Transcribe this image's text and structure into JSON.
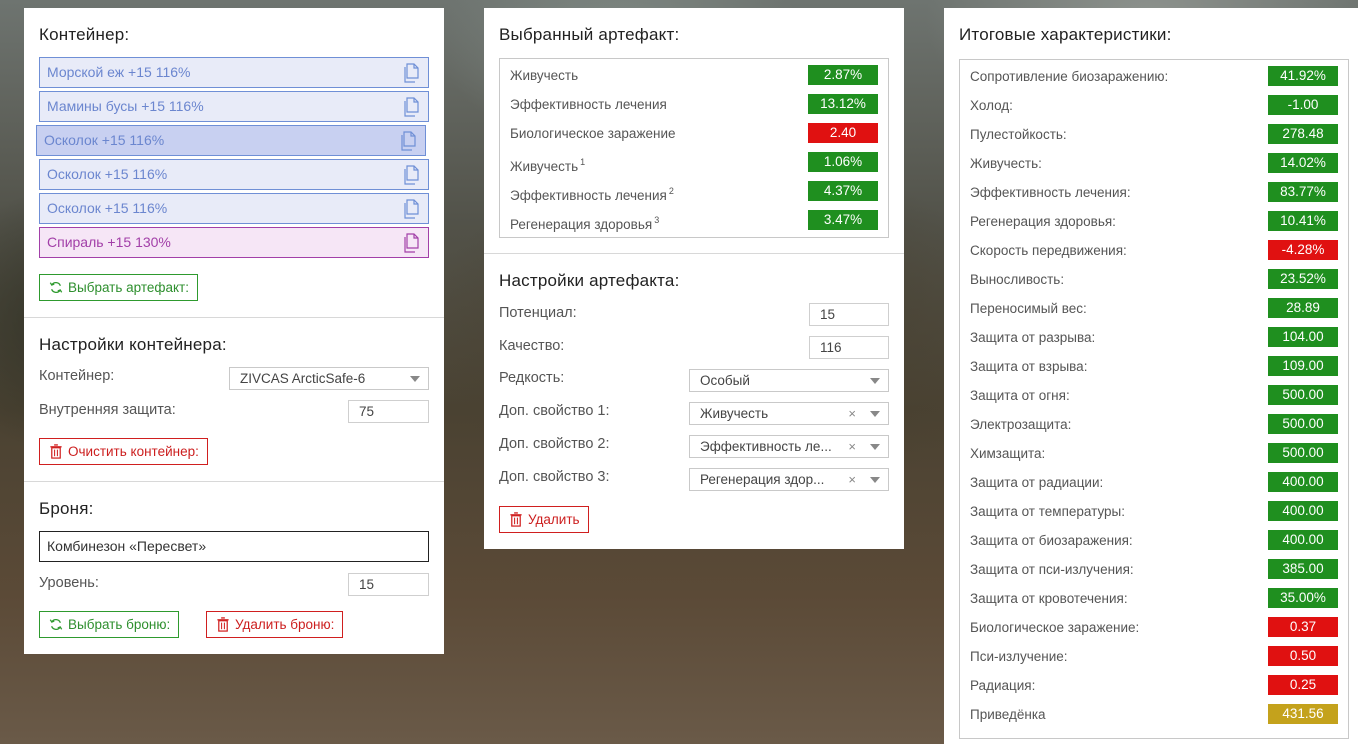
{
  "container_panel": {
    "title": "Контейнер:",
    "items": [
      {
        "label": "Морской еж +15 116%",
        "state": "normal"
      },
      {
        "label": "Мамины бусы +15 116%",
        "state": "normal"
      },
      {
        "label": "Осколок +15 116%",
        "state": "active"
      },
      {
        "label": "Осколок +15 116%",
        "state": "normal"
      },
      {
        "label": "Осколок +15 116%",
        "state": "normal"
      },
      {
        "label": "Спираль +15 130%",
        "state": "purple"
      }
    ],
    "select_artifact_label": "Выбрать артефакт:",
    "settings_title": "Настройки контейнера:",
    "container_label": "Контейнер:",
    "container_value": "ZIVCAS ArcticSafe-6",
    "inner_protection_label": "Внутренняя защита:",
    "inner_protection_value": "75",
    "clear_label": "Очистить контейнер:",
    "armor_title": "Броня:",
    "armor_value": "Комбинезон «Пересвет»",
    "level_label": "Уровень:",
    "level_value": "15",
    "select_armor_label": "Выбрать броню:",
    "delete_armor_label": "Удалить броню:"
  },
  "artifact_panel": {
    "title": "Выбранный артефакт:",
    "stats": [
      {
        "name": "Живучесть",
        "sup": "",
        "value": "2.87%",
        "color": "green"
      },
      {
        "name": "Эффективность лечения",
        "sup": "",
        "value": "13.12%",
        "color": "green"
      },
      {
        "name": "Биологическое заражение",
        "sup": "",
        "value": "2.40",
        "color": "red"
      },
      {
        "name": "Живучесть",
        "sup": "1",
        "value": "1.06%",
        "color": "green"
      },
      {
        "name": "Эффективность лечения",
        "sup": "2",
        "value": "4.37%",
        "color": "green"
      },
      {
        "name": "Регенерация здоровья",
        "sup": "3",
        "value": "3.47%",
        "color": "green"
      }
    ],
    "settings_title": "Настройки артефакта:",
    "potential_label": "Потенциал:",
    "potential_value": "15",
    "quality_label": "Качество:",
    "quality_value": "116",
    "rarity_label": "Редкость:",
    "rarity_value": "Особый",
    "prop1_label": "Доп. свойство 1:",
    "prop1_value": "Живучесть",
    "prop2_label": "Доп. свойство 2:",
    "prop2_value": "Эффективность ле...",
    "prop3_label": "Доп. свойство 3:",
    "prop3_value": "Регенерация здор...",
    "clear_symbol": "×",
    "delete_label": "Удалить"
  },
  "totals_panel": {
    "title": "Итоговые характеристики:",
    "stats": [
      {
        "name": "Сопротивление биозаражению:",
        "value": "41.92%",
        "color": "green"
      },
      {
        "name": "Холод:",
        "value": "-1.00",
        "color": "green"
      },
      {
        "name": "Пулестойкость:",
        "value": "278.48",
        "color": "green"
      },
      {
        "name": "Живучесть:",
        "value": "14.02%",
        "color": "green"
      },
      {
        "name": "Эффективность лечения:",
        "value": "83.77%",
        "color": "green"
      },
      {
        "name": "Регенерация здоровья:",
        "value": "10.41%",
        "color": "green"
      },
      {
        "name": "Скорость передвижения:",
        "value": "-4.28%",
        "color": "red"
      },
      {
        "name": "Выносливость:",
        "value": "23.52%",
        "color": "green"
      },
      {
        "name": "Переносимый вес:",
        "value": "28.89",
        "color": "green"
      },
      {
        "name": "Защита от разрыва:",
        "value": "104.00",
        "color": "green"
      },
      {
        "name": "Защита от взрыва:",
        "value": "109.00",
        "color": "green"
      },
      {
        "name": "Защита от огня:",
        "value": "500.00",
        "color": "green"
      },
      {
        "name": "Электрозащита:",
        "value": "500.00",
        "color": "green"
      },
      {
        "name": "Химзащита:",
        "value": "500.00",
        "color": "green"
      },
      {
        "name": "Защита от радиации:",
        "value": "400.00",
        "color": "green"
      },
      {
        "name": "Защита от температуры:",
        "value": "400.00",
        "color": "green"
      },
      {
        "name": "Защита от биозаражения:",
        "value": "400.00",
        "color": "green"
      },
      {
        "name": "Защита от пси-излучения:",
        "value": "385.00",
        "color": "green"
      },
      {
        "name": "Защита от кровотечения:",
        "value": "35.00%",
        "color": "green"
      },
      {
        "name": "Биологическое заражение:",
        "value": "0.37",
        "color": "red"
      },
      {
        "name": "Пси-излучение:",
        "value": "0.50",
        "color": "red"
      },
      {
        "name": "Радиация:",
        "value": "0.25",
        "color": "red"
      },
      {
        "name": "Приведёнка",
        "value": "431.56",
        "color": "yellow"
      }
    ]
  },
  "colors": {
    "green": "#1f8f1f",
    "red": "#e01111",
    "yellow": "#c4a21c",
    "container_blue": "#6f8fd6",
    "container_purple": "#a23fa8"
  }
}
